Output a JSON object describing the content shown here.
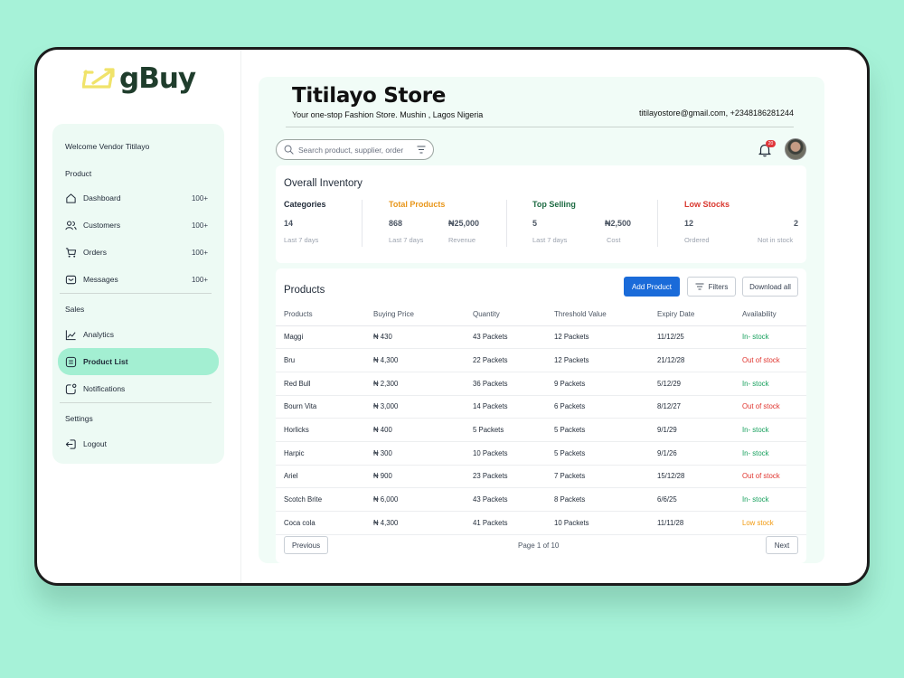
{
  "brand": {
    "logo_text": "gBuy"
  },
  "sidebar": {
    "welcome": "Welcome Vendor Titilayo",
    "section_product": "Product",
    "section_sales": "Sales",
    "section_settings": "Settings",
    "items": [
      {
        "label": "Dashboard",
        "count": "100+",
        "icon": "home-icon"
      },
      {
        "label": "Customers",
        "count": "100+",
        "icon": "users-icon"
      },
      {
        "label": "Orders",
        "count": "100+",
        "icon": "cart-icon"
      },
      {
        "label": "Messages",
        "count": "100+",
        "icon": "message-icon"
      },
      {
        "label": "Analytics",
        "icon": "chart-line-icon"
      },
      {
        "label": "Product List",
        "icon": "list-icon",
        "active": true
      },
      {
        "label": "Notifications",
        "icon": "notification-icon"
      },
      {
        "label": "Logout",
        "icon": "logout-icon"
      }
    ]
  },
  "header": {
    "store_name": "Titilayo Store",
    "tagline": "Your one-stop Fashion Store.  Mushin , Lagos Nigeria",
    "contact": "titilayostore@gmail.com, +2348186281244",
    "search_placeholder": "Search product, supplier, order",
    "notification_count": "20"
  },
  "inventory": {
    "title": "Overall Inventory",
    "categories": {
      "label": "Categories",
      "value": "14",
      "sub": "Last 7 days"
    },
    "total_products": {
      "label": "Total Products",
      "value": "868",
      "value2": "₦25,000",
      "sub": "Last 7 days",
      "sub2": "Revenue"
    },
    "top_selling": {
      "label": "Top Selling",
      "value": "5",
      "value2": "₦2,500",
      "sub": "Last 7 days",
      "sub2": "Cost"
    },
    "low_stocks": {
      "label": "Low Stocks",
      "value": "12",
      "value2": "2",
      "sub": "Ordered",
      "sub2": "Not in stock"
    }
  },
  "products": {
    "title": "Products",
    "add_button": "Add Product",
    "filters_button": "Filters",
    "download_button": "Download all",
    "columns": [
      "Products",
      "Buying Price",
      "Quantity",
      "Threshold Value",
      "Expiry Date",
      "Availability"
    ],
    "rows": [
      {
        "name": "Maggi",
        "price": "₦ 430",
        "qty": "43 Packets",
        "threshold": "12 Packets",
        "expiry": "11/12/25",
        "availability": "In- stock",
        "status": "green"
      },
      {
        "name": "Bru",
        "price": "₦ 4,300",
        "qty": "22 Packets",
        "threshold": "12 Packets",
        "expiry": "21/12/28",
        "availability": "Out of stock",
        "status": "red"
      },
      {
        "name": "Red Bull",
        "price": "₦ 2,300",
        "qty": "36 Packets",
        "threshold": "9 Packets",
        "expiry": "5/12/29",
        "availability": "In- stock",
        "status": "green"
      },
      {
        "name": "Bourn Vita",
        "price": "₦ 3,000",
        "qty": "14 Packets",
        "threshold": "6 Packets",
        "expiry": "8/12/27",
        "availability": "Out of stock",
        "status": "red"
      },
      {
        "name": "Horlicks",
        "price": "₦ 400",
        "qty": "5 Packets",
        "threshold": "5 Packets",
        "expiry": "9/1/29",
        "availability": "In- stock",
        "status": "green"
      },
      {
        "name": "Harpic",
        "price": "₦ 300",
        "qty": "10 Packets",
        "threshold": "5 Packets",
        "expiry": "9/1/26",
        "availability": "In- stock",
        "status": "green"
      },
      {
        "name": "Ariel",
        "price": "₦ 900",
        "qty": "23 Packets",
        "threshold": "7 Packets",
        "expiry": "15/12/28",
        "availability": "Out of stock",
        "status": "red"
      },
      {
        "name": "Scotch Brite",
        "price": "₦ 6,000",
        "qty": "43 Packets",
        "threshold": "8 Packets",
        "expiry": "6/6/25",
        "availability": "In- stock",
        "status": "green"
      },
      {
        "name": "Coca cola",
        "price": "₦ 4,300",
        "qty": "41 Packets",
        "threshold": "10 Packets",
        "expiry": "11/11/28",
        "availability": "Low  stock",
        "status": "orange"
      }
    ],
    "pagination": {
      "previous": "Previous",
      "page_info": "Page 1 of 10",
      "next": "Next"
    }
  },
  "colors": {
    "background": "#a6f2d8",
    "accent": "#1a6bd9",
    "active_nav": "#a3efd2",
    "total_products": "#e8961a",
    "top_selling": "#1e6b43",
    "low_stocks": "#d9382f"
  }
}
